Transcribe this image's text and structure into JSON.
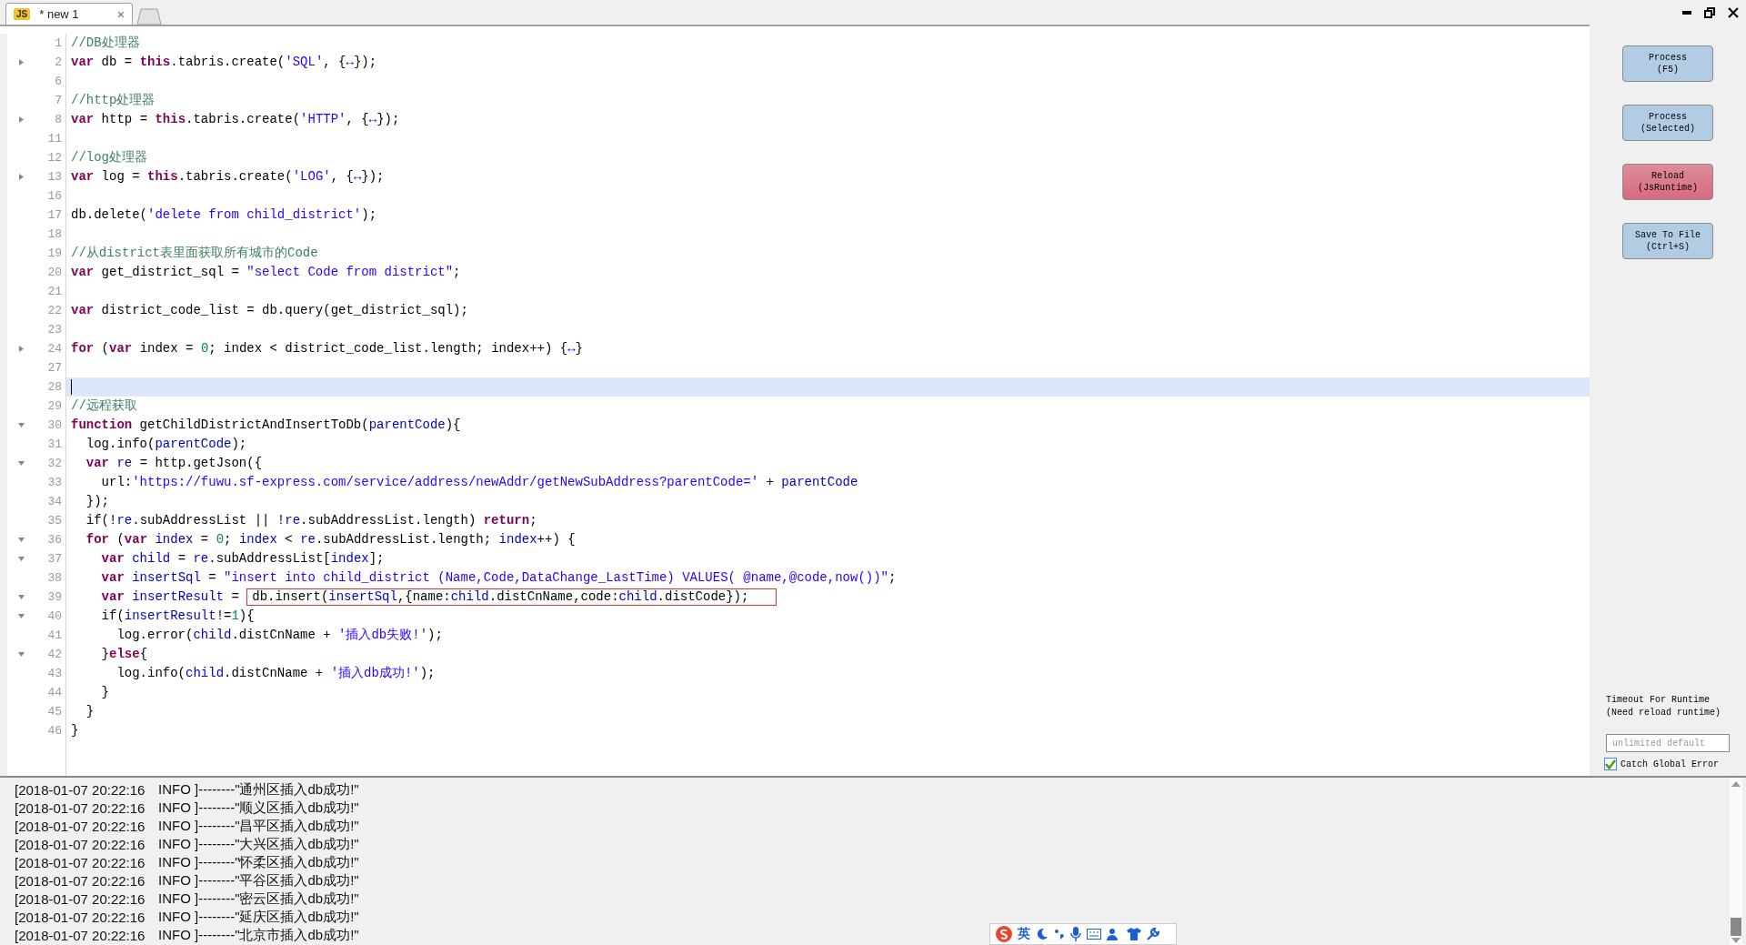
{
  "tabs": [
    {
      "icon_text": "JS",
      "title": "* new 1",
      "close": "×",
      "selected": true
    }
  ],
  "editor": {
    "lines": [
      {
        "number": "1",
        "current": false,
        "tokens": [
          {
            "kind": "comment",
            "text": "//DB处理器"
          }
        ]
      },
      {
        "number": "2",
        "current": false,
        "collapsed": true,
        "tokens": [
          {
            "kind": "kw",
            "text": "var"
          },
          {
            "kind": "plain",
            "text": " db = "
          },
          {
            "kind": "kw",
            "text": "this"
          },
          {
            "kind": "plain",
            "text": ".tabris.create("
          },
          {
            "kind": "str",
            "text": "'SQL'"
          },
          {
            "kind": "plain",
            "text": ", {"
          },
          {
            "kind": "fold",
            "text": "↔"
          },
          {
            "kind": "plain",
            "text": "});"
          }
        ]
      },
      {
        "number": "6",
        "current": false
      },
      {
        "number": "7",
        "current": false,
        "tokens": [
          {
            "kind": "comment",
            "text": "//http处理器"
          }
        ]
      },
      {
        "number": "8",
        "current": false,
        "collapsed": true,
        "tokens": [
          {
            "kind": "kw",
            "text": "var"
          },
          {
            "kind": "plain",
            "text": " http = "
          },
          {
            "kind": "kw",
            "text": "this"
          },
          {
            "kind": "plain",
            "text": ".tabris.create("
          },
          {
            "kind": "str",
            "text": "'HTTP'"
          },
          {
            "kind": "plain",
            "text": ", {"
          },
          {
            "kind": "fold",
            "text": "↔"
          },
          {
            "kind": "plain",
            "text": "});"
          }
        ]
      },
      {
        "number": "11",
        "current": false
      },
      {
        "number": "12",
        "current": false,
        "tokens": [
          {
            "kind": "comment",
            "text": "//log处理器"
          }
        ]
      },
      {
        "number": "13",
        "current": false,
        "collapsed": true,
        "tokens": [
          {
            "kind": "kw",
            "text": "var"
          },
          {
            "kind": "plain",
            "text": " log = "
          },
          {
            "kind": "kw",
            "text": "this"
          },
          {
            "kind": "plain",
            "text": ".tabris.create("
          },
          {
            "kind": "str",
            "text": "'LOG'"
          },
          {
            "kind": "plain",
            "text": ", {"
          },
          {
            "kind": "fold",
            "text": "↔"
          },
          {
            "kind": "plain",
            "text": "});"
          }
        ]
      },
      {
        "number": "16",
        "current": false
      },
      {
        "number": "17",
        "current": false,
        "tokens": [
          {
            "kind": "plain",
            "text": "db.delete("
          },
          {
            "kind": "str",
            "text": "'delete from child_district'"
          },
          {
            "kind": "plain",
            "text": ");"
          }
        ]
      },
      {
        "number": "18",
        "current": false
      },
      {
        "number": "19",
        "current": false,
        "tokens": [
          {
            "kind": "comment",
            "text": "//从district表里面获取所有城市的Code"
          }
        ]
      },
      {
        "number": "20",
        "current": false,
        "tokens": [
          {
            "kind": "kw",
            "text": "var"
          },
          {
            "kind": "plain",
            "text": " get_district_sql = "
          },
          {
            "kind": "str",
            "text": "\"select Code from district\""
          },
          {
            "kind": "plain",
            "text": ";"
          }
        ]
      },
      {
        "number": "21",
        "current": false
      },
      {
        "number": "22",
        "current": false,
        "tokens": [
          {
            "kind": "kw",
            "text": "var"
          },
          {
            "kind": "plain",
            "text": " district_code_list = db.query(get_district_sql);"
          }
        ]
      },
      {
        "number": "23",
        "current": false
      },
      {
        "number": "24",
        "current": false,
        "collapsed": true,
        "tokens": [
          {
            "kind": "kw",
            "text": "for"
          },
          {
            "kind": "plain",
            "text": " ("
          },
          {
            "kind": "kw",
            "text": "var"
          },
          {
            "kind": "plain",
            "text": " index = "
          },
          {
            "kind": "num",
            "text": "0"
          },
          {
            "kind": "plain",
            "text": "; index < district_code_list.length; index++) {"
          },
          {
            "kind": "fold",
            "text": "↔"
          },
          {
            "kind": "plain",
            "text": "}"
          }
        ]
      },
      {
        "number": "27",
        "current": false
      },
      {
        "number": "28",
        "current": true
      },
      {
        "number": "29",
        "current": false,
        "tokens": [
          {
            "kind": "comment",
            "text": "//远程获取"
          }
        ]
      },
      {
        "number": "30",
        "current": false,
        "collapsed": false,
        "tokens": [
          {
            "kind": "kw",
            "text": "function"
          },
          {
            "kind": "plain",
            "text": " getChildDistrictAndInsertToDb("
          },
          {
            "kind": "var",
            "text": "parentCode"
          },
          {
            "kind": "plain",
            "text": "){"
          }
        ]
      },
      {
        "number": "31",
        "current": false,
        "tokens": [
          {
            "kind": "plain",
            "text": "  log.info("
          },
          {
            "kind": "var",
            "text": "parentCode"
          },
          {
            "kind": "plain",
            "text": ");"
          }
        ]
      },
      {
        "number": "32",
        "current": false,
        "collapsed": false,
        "tokens": [
          {
            "kind": "kw",
            "text": "  var "
          },
          {
            "kind": "var",
            "text": "re"
          },
          {
            "kind": "plain",
            "text": " = http.getJson({"
          }
        ]
      },
      {
        "number": "33",
        "current": false,
        "tokens": [
          {
            "kind": "plain",
            "text": "    url:"
          },
          {
            "kind": "str",
            "text": "'https://fuwu.sf-express.com/service/address/newAddr/getNewSubAddress?parentCode='"
          },
          {
            "kind": "plain",
            "text": " + "
          },
          {
            "kind": "var",
            "text": "parentCode"
          }
        ]
      },
      {
        "number": "34",
        "current": false,
        "tokens": [
          {
            "kind": "plain",
            "text": "  });"
          }
        ]
      },
      {
        "number": "35",
        "current": false,
        "tokens": [
          {
            "kind": "plain",
            "text": "  if(!"
          },
          {
            "kind": "var",
            "text": "re"
          },
          {
            "kind": "plain",
            "text": ".subAddressList || !"
          },
          {
            "kind": "var",
            "text": "re"
          },
          {
            "kind": "plain",
            "text": ".subAddressList.length) "
          },
          {
            "kind": "kw",
            "text": "return"
          },
          {
            "kind": "plain",
            "text": ";"
          }
        ]
      },
      {
        "number": "36",
        "current": false,
        "collapsed": false,
        "tokens": [
          {
            "kind": "kw",
            "text": "  for"
          },
          {
            "kind": "plain",
            "text": " ("
          },
          {
            "kind": "kw",
            "text": "var "
          },
          {
            "kind": "var",
            "text": "index"
          },
          {
            "kind": "plain",
            "text": " = "
          },
          {
            "kind": "num",
            "text": "0"
          },
          {
            "kind": "plain",
            "text": "; "
          },
          {
            "kind": "var",
            "text": "index"
          },
          {
            "kind": "plain",
            "text": " < "
          },
          {
            "kind": "var",
            "text": "re"
          },
          {
            "kind": "plain",
            "text": ".subAddressList.length; "
          },
          {
            "kind": "var",
            "text": "index"
          },
          {
            "kind": "plain",
            "text": "++) {"
          }
        ]
      },
      {
        "number": "37",
        "current": false,
        "collapsed": false,
        "tokens": [
          {
            "kind": "kw",
            "text": "    var "
          },
          {
            "kind": "var",
            "text": "child"
          },
          {
            "kind": "plain",
            "text": " = "
          },
          {
            "kind": "var",
            "text": "re"
          },
          {
            "kind": "plain",
            "text": ".subAddressList["
          },
          {
            "kind": "var",
            "text": "index"
          },
          {
            "kind": "plain",
            "text": "];"
          }
        ]
      },
      {
        "number": "38",
        "current": false,
        "tokens": [
          {
            "kind": "kw",
            "text": "    var "
          },
          {
            "kind": "var",
            "text": "insertSql"
          },
          {
            "kind": "plain",
            "text": " = "
          },
          {
            "kind": "str",
            "text": "\"insert into child_district (Name,Code,DataChange_LastTime) VALUES( @name,@code,now())\""
          },
          {
            "kind": "plain",
            "text": ";"
          }
        ]
      },
      {
        "number": "39",
        "current": false,
        "collapsed": false,
        "tokens": [
          {
            "kind": "kw",
            "text": "    var "
          },
          {
            "kind": "var",
            "text": "insertResult"
          },
          {
            "kind": "plain",
            "text": " = "
          },
          {
            "kind": "group",
            "boxed": true,
            "tokens": [
              {
                "kind": "plain",
                "text": "db.insert("
              },
              {
                "kind": "var",
                "text": "insertSql"
              },
              {
                "kind": "plain",
                "text": ",{name:"
              },
              {
                "kind": "var",
                "text": "child"
              },
              {
                "kind": "plain",
                "text": ".distCnName,code:"
              },
              {
                "kind": "var",
                "text": "child"
              },
              {
                "kind": "plain",
                "text": ".distCode});"
              }
            ]
          }
        ]
      },
      {
        "number": "40",
        "current": false,
        "collapsed": false,
        "tokens": [
          {
            "kind": "plain",
            "text": "    if("
          },
          {
            "kind": "var",
            "text": "insertResult"
          },
          {
            "kind": "plain",
            "text": "!="
          },
          {
            "kind": "num",
            "text": "1"
          },
          {
            "kind": "plain",
            "text": "){"
          }
        ]
      },
      {
        "number": "41",
        "current": false,
        "tokens": [
          {
            "kind": "plain",
            "text": "      log.error("
          },
          {
            "kind": "var",
            "text": "child"
          },
          {
            "kind": "plain",
            "text": ".distCnName + "
          },
          {
            "kind": "str",
            "text": "'插入db失败!'"
          },
          {
            "kind": "plain",
            "text": ");"
          }
        ]
      },
      {
        "number": "42",
        "current": false,
        "collapsed": false,
        "tokens": [
          {
            "kind": "plain",
            "text": "    }"
          },
          {
            "kind": "kw",
            "text": "else"
          },
          {
            "kind": "plain",
            "text": "{"
          }
        ]
      },
      {
        "number": "43",
        "current": false,
        "tokens": [
          {
            "kind": "plain",
            "text": "      log.info("
          },
          {
            "kind": "var",
            "text": "child"
          },
          {
            "kind": "plain",
            "text": ".distCnName + "
          },
          {
            "kind": "str",
            "text": "'插入db成功!'"
          },
          {
            "kind": "plain",
            "text": ");"
          }
        ]
      },
      {
        "number": "44",
        "current": false,
        "tokens": [
          {
            "kind": "plain",
            "text": "    }"
          }
        ]
      },
      {
        "number": "45",
        "current": false,
        "tokens": [
          {
            "kind": "plain",
            "text": "  }"
          }
        ]
      },
      {
        "number": "46",
        "current": false,
        "tokens": [
          {
            "kind": "plain",
            "text": "}"
          }
        ]
      }
    ]
  },
  "side_panel": {
    "buttons": [
      {
        "lines": [
          "Process",
          "(F5)"
        ],
        "kind": "normal"
      },
      {
        "lines": [
          "Process",
          "(Selected)"
        ],
        "kind": "normal"
      },
      {
        "lines": [
          "Reload",
          "(JsRuntime)"
        ],
        "kind": "warning"
      },
      {
        "lines": [
          "Save To File",
          "(Ctrl+S)"
        ],
        "kind": "normal"
      }
    ],
    "timeout_label": [
      "Timeout For Runtime",
      "(Need reload runtime)"
    ],
    "timeout_field": {
      "placeholder": "unlimited default"
    },
    "catch_error": {
      "label": "Catch Global Error",
      "checked": true
    }
  },
  "log": [
    {
      "time": "[2018-01-07 20:22:16",
      "message": "INFO ]--------\"通州区插入db成功!\""
    },
    {
      "time": "[2018-01-07 20:22:16",
      "message": "INFO ]--------\"顺义区插入db成功!\""
    },
    {
      "time": "[2018-01-07 20:22:16",
      "message": "INFO ]--------\"昌平区插入db成功!\""
    },
    {
      "time": "[2018-01-07 20:22:16",
      "message": "INFO ]--------\"大兴区插入db成功!\""
    },
    {
      "time": "[2018-01-07 20:22:16",
      "message": "INFO ]--------\"怀柔区插入db成功!\""
    },
    {
      "time": "[2018-01-07 20:22:16",
      "message": "INFO ]--------\"平谷区插入db成功!\""
    },
    {
      "time": "[2018-01-07 20:22:16",
      "message": "INFO ]--------\"密云区插入db成功!\""
    },
    {
      "time": "[2018-01-07 20:22:16",
      "message": "INFO ]--------\"延庆区插入db成功!\""
    },
    {
      "time": "[2018-01-07 20:22:16",
      "message": "INFO ]--------\"北京市插入db成功!\""
    }
  ],
  "ime_bar": {
    "language": "英"
  }
}
